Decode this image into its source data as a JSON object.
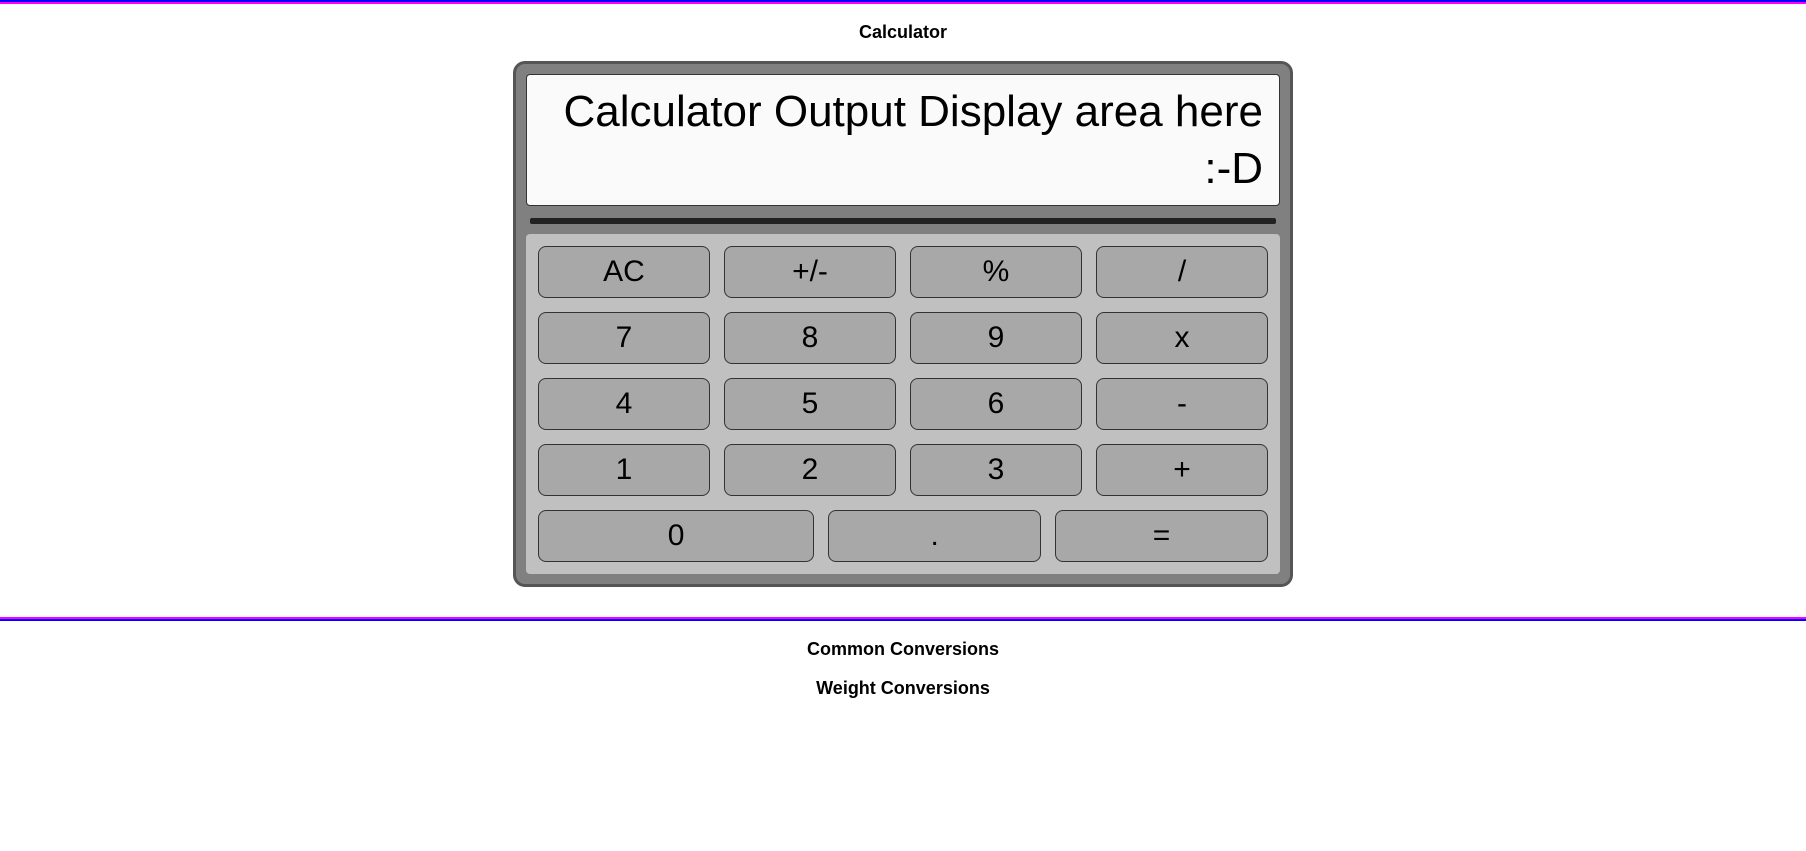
{
  "sections": {
    "calculator_title": "Calculator",
    "conversions_title": "Common Conversions",
    "weight_title": "Weight Conversions"
  },
  "calculator": {
    "display": "Calculator Output Display area here :-D",
    "rows": [
      [
        {
          "label": "AC",
          "name": "ac-button"
        },
        {
          "label": "+/-",
          "name": "sign-button"
        },
        {
          "label": "%",
          "name": "percent-button"
        },
        {
          "label": "/",
          "name": "divide-button"
        }
      ],
      [
        {
          "label": "7",
          "name": "digit-7-button"
        },
        {
          "label": "8",
          "name": "digit-8-button"
        },
        {
          "label": "9",
          "name": "digit-9-button"
        },
        {
          "label": "x",
          "name": "multiply-button"
        }
      ],
      [
        {
          "label": "4",
          "name": "digit-4-button"
        },
        {
          "label": "5",
          "name": "digit-5-button"
        },
        {
          "label": "6",
          "name": "digit-6-button"
        },
        {
          "label": "-",
          "name": "minus-button"
        }
      ],
      [
        {
          "label": "1",
          "name": "digit-1-button"
        },
        {
          "label": "2",
          "name": "digit-2-button"
        },
        {
          "label": "3",
          "name": "digit-3-button"
        },
        {
          "label": "+",
          "name": "plus-button"
        }
      ],
      [
        {
          "label": "0",
          "name": "digit-0-button",
          "wide": true
        },
        {
          "label": ".",
          "name": "decimal-button"
        },
        {
          "label": "=",
          "name": "equals-button"
        }
      ]
    ]
  }
}
